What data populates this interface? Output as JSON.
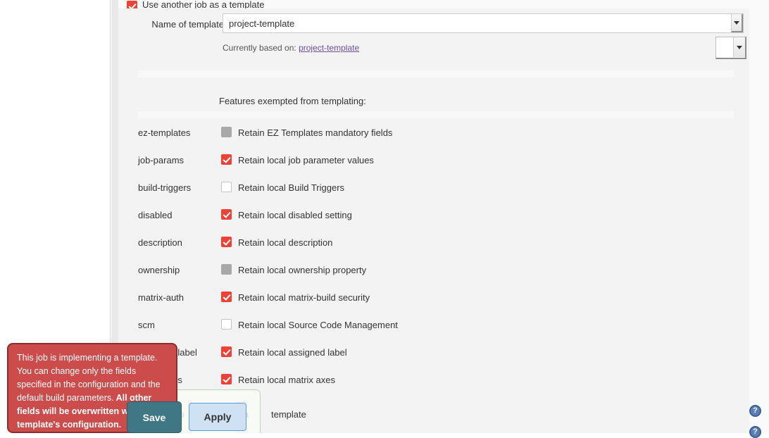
{
  "page": {
    "use_template_checkbox_label": "Use another job as a template",
    "features_heading": "Features exempted from templating:"
  },
  "template_field": {
    "label": "Name of template",
    "value": "project-template",
    "placeholder": "",
    "based_on_prefix": "Currently based on:",
    "based_on_link": "project-template"
  },
  "features": [
    {
      "key": "ez-templates",
      "label": "Retain EZ Templates mandatory fields",
      "state": "disabled"
    },
    {
      "key": "job-params",
      "label": "Retain local job parameter values",
      "state": "checked"
    },
    {
      "key": "build-triggers",
      "label": "Retain local Build Triggers",
      "state": "unchecked"
    },
    {
      "key": "disabled",
      "label": "Retain local disabled setting",
      "state": "checked"
    },
    {
      "key": "description",
      "label": "Retain local description",
      "state": "checked"
    },
    {
      "key": "ownership",
      "label": "Retain local ownership property",
      "state": "disabled"
    },
    {
      "key": "matrix-auth",
      "label": "Retain local matrix-build security",
      "state": "checked"
    },
    {
      "key": "scm",
      "label": "Retain local Source Code Management",
      "state": "unchecked"
    },
    {
      "key": "assigned-label",
      "label": "Retain local assigned label",
      "state": "checked"
    },
    {
      "key": "matrix-axis",
      "label": "Retain local matrix axes",
      "state": "checked"
    }
  ],
  "tooltip": {
    "line1": "This job is implementing a template.",
    "line2": "You can change only the fields",
    "line3": "specified in the configuration and the",
    "line4_normal": "default build parameters.",
    "line4_strong": " All other",
    "line5_strong": "fields will be overwritten with the",
    "line6_strong": "template's configuration."
  },
  "buttons": {
    "save": "Save",
    "apply": "Apply"
  },
  "bottom_box": {
    "obscured_text_start": "job",
    "obscured_text_mid": "as a",
    "trailing_text": "template"
  },
  "icons": {
    "help": "?",
    "dropdown": "chevron-down-icon"
  },
  "colors": {
    "accent_checked": "#ef4136",
    "tooltip_bg": "#cc4b4b",
    "save_bg": "#3f7784",
    "apply_bg": "#cfe2f3",
    "link": "#6a4f9c"
  }
}
